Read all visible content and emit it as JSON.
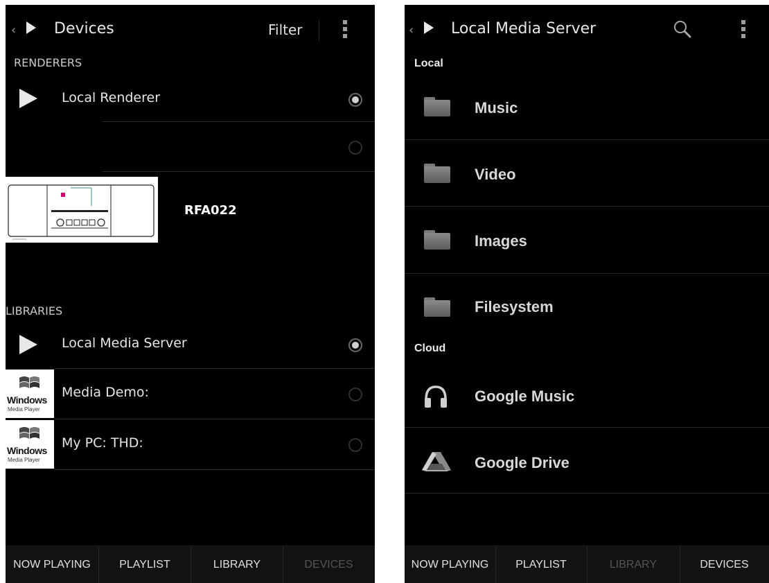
{
  "left": {
    "header": {
      "title": "Devices",
      "filter_label": "Filter"
    },
    "renderers_label": "RENDERERS",
    "renderers": [
      {
        "label": "Local Renderer",
        "selected": true
      },
      {
        "label": "",
        "selected": false
      },
      {
        "label": "RFA022",
        "selected": false
      }
    ],
    "libraries_label": "LIBRARIES",
    "libraries": [
      {
        "label": "Local Media Server",
        "selected": true
      },
      {
        "label": "Media Demo:",
        "selected": false,
        "icon_text": "Windows",
        "icon_sub": "Media Player"
      },
      {
        "label": "My PC:  THD:",
        "selected": false,
        "icon_text": "Windows",
        "icon_sub": "Media Player"
      }
    ],
    "tabs": [
      {
        "label": "NOW PLAYING",
        "active": false
      },
      {
        "label": "PLAYLIST",
        "active": false
      },
      {
        "label": "LIBRARY",
        "active": false
      },
      {
        "label": "DEVICES",
        "active": true
      }
    ]
  },
  "right": {
    "header": {
      "title": "Local Media Server"
    },
    "local_label": "Local",
    "local_items": [
      "Music",
      "Video",
      "Images",
      "Filesystem"
    ],
    "cloud_label": "Cloud",
    "cloud_items": [
      "Google Music",
      "Google Drive"
    ],
    "tabs": [
      {
        "label": "NOW PLAYING",
        "active": false
      },
      {
        "label": "PLAYLIST",
        "active": false
      },
      {
        "label": "LIBRARY",
        "active": true
      },
      {
        "label": "DEVICES",
        "active": false
      }
    ]
  },
  "colors": {
    "background": "#000000",
    "text": "#e6e6e6",
    "dim_tab": "#555555",
    "bottom_bar": "#121212"
  }
}
